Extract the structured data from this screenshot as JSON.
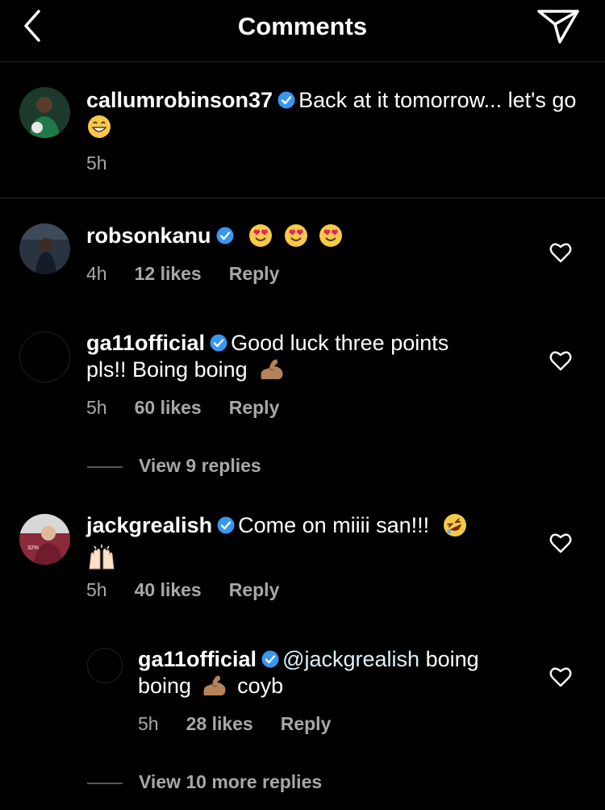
{
  "header": {
    "title": "Comments",
    "back_icon": "chevron-left-icon",
    "share_icon": "paper-plane-icon"
  },
  "caption": {
    "username": "callumrobinson37",
    "text": "Back at it tomorrow... let's go",
    "time": "5h"
  },
  "comments": [
    {
      "username": "robsonkanu",
      "time": "4h",
      "likes": "12 likes",
      "reply": "Reply"
    },
    {
      "username": "ga11official",
      "text1": "Good luck three points",
      "text2": "pls!! Boing boing",
      "time": "5h",
      "likes": "60 likes",
      "reply": "Reply",
      "view_replies": "View 9 replies"
    },
    {
      "username": "jackgrealish",
      "text": "Come on miiii san!!!",
      "time": "5h",
      "likes": "40 likes",
      "reply": "Reply",
      "reply_item": {
        "username": "ga11official",
        "mention": "@jackgrealish",
        "text1": "boing",
        "text2a": "boing",
        "text2b": "coyb",
        "time": "5h",
        "likes": "28 likes",
        "reply": "Reply"
      },
      "view_more": "View 10 more replies"
    }
  ],
  "colors": {
    "background": "#000000",
    "muted": "#a8a8a8",
    "verified": "#3897f0",
    "divider": "#262626"
  }
}
